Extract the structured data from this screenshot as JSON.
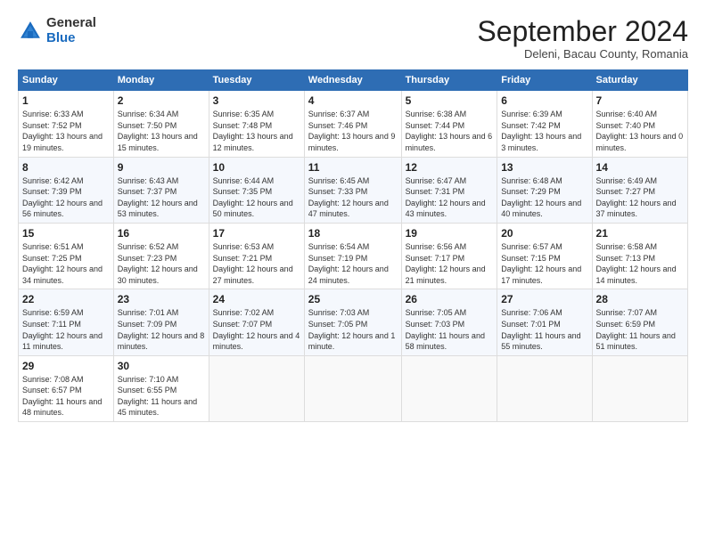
{
  "logo": {
    "general": "General",
    "blue": "Blue"
  },
  "header": {
    "month": "September 2024",
    "location": "Deleni, Bacau County, Romania"
  },
  "days_of_week": [
    "Sunday",
    "Monday",
    "Tuesday",
    "Wednesday",
    "Thursday",
    "Friday",
    "Saturday"
  ],
  "weeks": [
    [
      {
        "day": "1",
        "sunrise": "6:33 AM",
        "sunset": "7:52 PM",
        "daylight": "13 hours and 19 minutes."
      },
      {
        "day": "2",
        "sunrise": "6:34 AM",
        "sunset": "7:50 PM",
        "daylight": "13 hours and 15 minutes."
      },
      {
        "day": "3",
        "sunrise": "6:35 AM",
        "sunset": "7:48 PM",
        "daylight": "13 hours and 12 minutes."
      },
      {
        "day": "4",
        "sunrise": "6:37 AM",
        "sunset": "7:46 PM",
        "daylight": "13 hours and 9 minutes."
      },
      {
        "day": "5",
        "sunrise": "6:38 AM",
        "sunset": "7:44 PM",
        "daylight": "13 hours and 6 minutes."
      },
      {
        "day": "6",
        "sunrise": "6:39 AM",
        "sunset": "7:42 PM",
        "daylight": "13 hours and 3 minutes."
      },
      {
        "day": "7",
        "sunrise": "6:40 AM",
        "sunset": "7:40 PM",
        "daylight": "13 hours and 0 minutes."
      }
    ],
    [
      {
        "day": "8",
        "sunrise": "6:42 AM",
        "sunset": "7:39 PM",
        "daylight": "12 hours and 56 minutes."
      },
      {
        "day": "9",
        "sunrise": "6:43 AM",
        "sunset": "7:37 PM",
        "daylight": "12 hours and 53 minutes."
      },
      {
        "day": "10",
        "sunrise": "6:44 AM",
        "sunset": "7:35 PM",
        "daylight": "12 hours and 50 minutes."
      },
      {
        "day": "11",
        "sunrise": "6:45 AM",
        "sunset": "7:33 PM",
        "daylight": "12 hours and 47 minutes."
      },
      {
        "day": "12",
        "sunrise": "6:47 AM",
        "sunset": "7:31 PM",
        "daylight": "12 hours and 43 minutes."
      },
      {
        "day": "13",
        "sunrise": "6:48 AM",
        "sunset": "7:29 PM",
        "daylight": "12 hours and 40 minutes."
      },
      {
        "day": "14",
        "sunrise": "6:49 AM",
        "sunset": "7:27 PM",
        "daylight": "12 hours and 37 minutes."
      }
    ],
    [
      {
        "day": "15",
        "sunrise": "6:51 AM",
        "sunset": "7:25 PM",
        "daylight": "12 hours and 34 minutes."
      },
      {
        "day": "16",
        "sunrise": "6:52 AM",
        "sunset": "7:23 PM",
        "daylight": "12 hours and 30 minutes."
      },
      {
        "day": "17",
        "sunrise": "6:53 AM",
        "sunset": "7:21 PM",
        "daylight": "12 hours and 27 minutes."
      },
      {
        "day": "18",
        "sunrise": "6:54 AM",
        "sunset": "7:19 PM",
        "daylight": "12 hours and 24 minutes."
      },
      {
        "day": "19",
        "sunrise": "6:56 AM",
        "sunset": "7:17 PM",
        "daylight": "12 hours and 21 minutes."
      },
      {
        "day": "20",
        "sunrise": "6:57 AM",
        "sunset": "7:15 PM",
        "daylight": "12 hours and 17 minutes."
      },
      {
        "day": "21",
        "sunrise": "6:58 AM",
        "sunset": "7:13 PM",
        "daylight": "12 hours and 14 minutes."
      }
    ],
    [
      {
        "day": "22",
        "sunrise": "6:59 AM",
        "sunset": "7:11 PM",
        "daylight": "12 hours and 11 minutes."
      },
      {
        "day": "23",
        "sunrise": "7:01 AM",
        "sunset": "7:09 PM",
        "daylight": "12 hours and 8 minutes."
      },
      {
        "day": "24",
        "sunrise": "7:02 AM",
        "sunset": "7:07 PM",
        "daylight": "12 hours and 4 minutes."
      },
      {
        "day": "25",
        "sunrise": "7:03 AM",
        "sunset": "7:05 PM",
        "daylight": "12 hours and 1 minute."
      },
      {
        "day": "26",
        "sunrise": "7:05 AM",
        "sunset": "7:03 PM",
        "daylight": "11 hours and 58 minutes."
      },
      {
        "day": "27",
        "sunrise": "7:06 AM",
        "sunset": "7:01 PM",
        "daylight": "11 hours and 55 minutes."
      },
      {
        "day": "28",
        "sunrise": "7:07 AM",
        "sunset": "6:59 PM",
        "daylight": "11 hours and 51 minutes."
      }
    ],
    [
      {
        "day": "29",
        "sunrise": "7:08 AM",
        "sunset": "6:57 PM",
        "daylight": "11 hours and 48 minutes."
      },
      {
        "day": "30",
        "sunrise": "7:10 AM",
        "sunset": "6:55 PM",
        "daylight": "11 hours and 45 minutes."
      },
      null,
      null,
      null,
      null,
      null
    ]
  ]
}
